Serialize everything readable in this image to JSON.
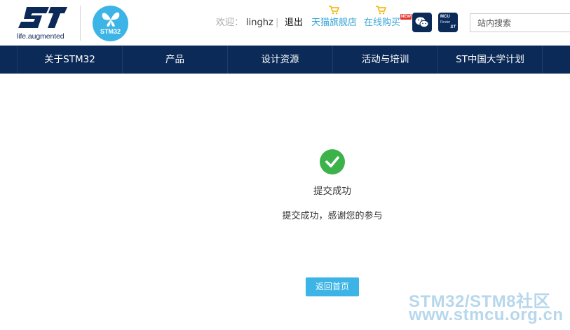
{
  "header": {
    "logo_tagline": "life.augmented",
    "stm32_logo_text": "STM32",
    "welcome_label": "欢迎：",
    "username": "linghz",
    "separator": "|",
    "logout_label": "退出",
    "tmall_label": "天猫旗舰店",
    "online_buy_label": "在线购买",
    "new_badge": "NEW",
    "mcu_finder_line1": "MCU",
    "mcu_finder_line2": "Finder",
    "mcu_finder_line3": "ST",
    "search_placeholder": "站内搜索"
  },
  "nav": {
    "items": [
      {
        "label": "关于STM32"
      },
      {
        "label": "产品"
      },
      {
        "label": "设计资源"
      },
      {
        "label": "活动与培训"
      },
      {
        "label": "ST中国大学计划"
      }
    ]
  },
  "content": {
    "status_title": "提交成功",
    "status_message": "提交成功，感谢您的参与",
    "home_button_label": "返回首页"
  },
  "watermark": {
    "line1": "STM32/STM8社区",
    "line2": "www.stmcu.org.cn"
  },
  "colors": {
    "brand_navy": "#0b2a57",
    "accent_blue": "#3cb4e5",
    "success_green": "#3cb34a",
    "link_blue": "#36a6d6"
  },
  "icons": [
    "st-logo",
    "stm32-butterfly-logo",
    "cart-icon",
    "wechat-icon",
    "mcu-finder-icon",
    "check-icon"
  ]
}
